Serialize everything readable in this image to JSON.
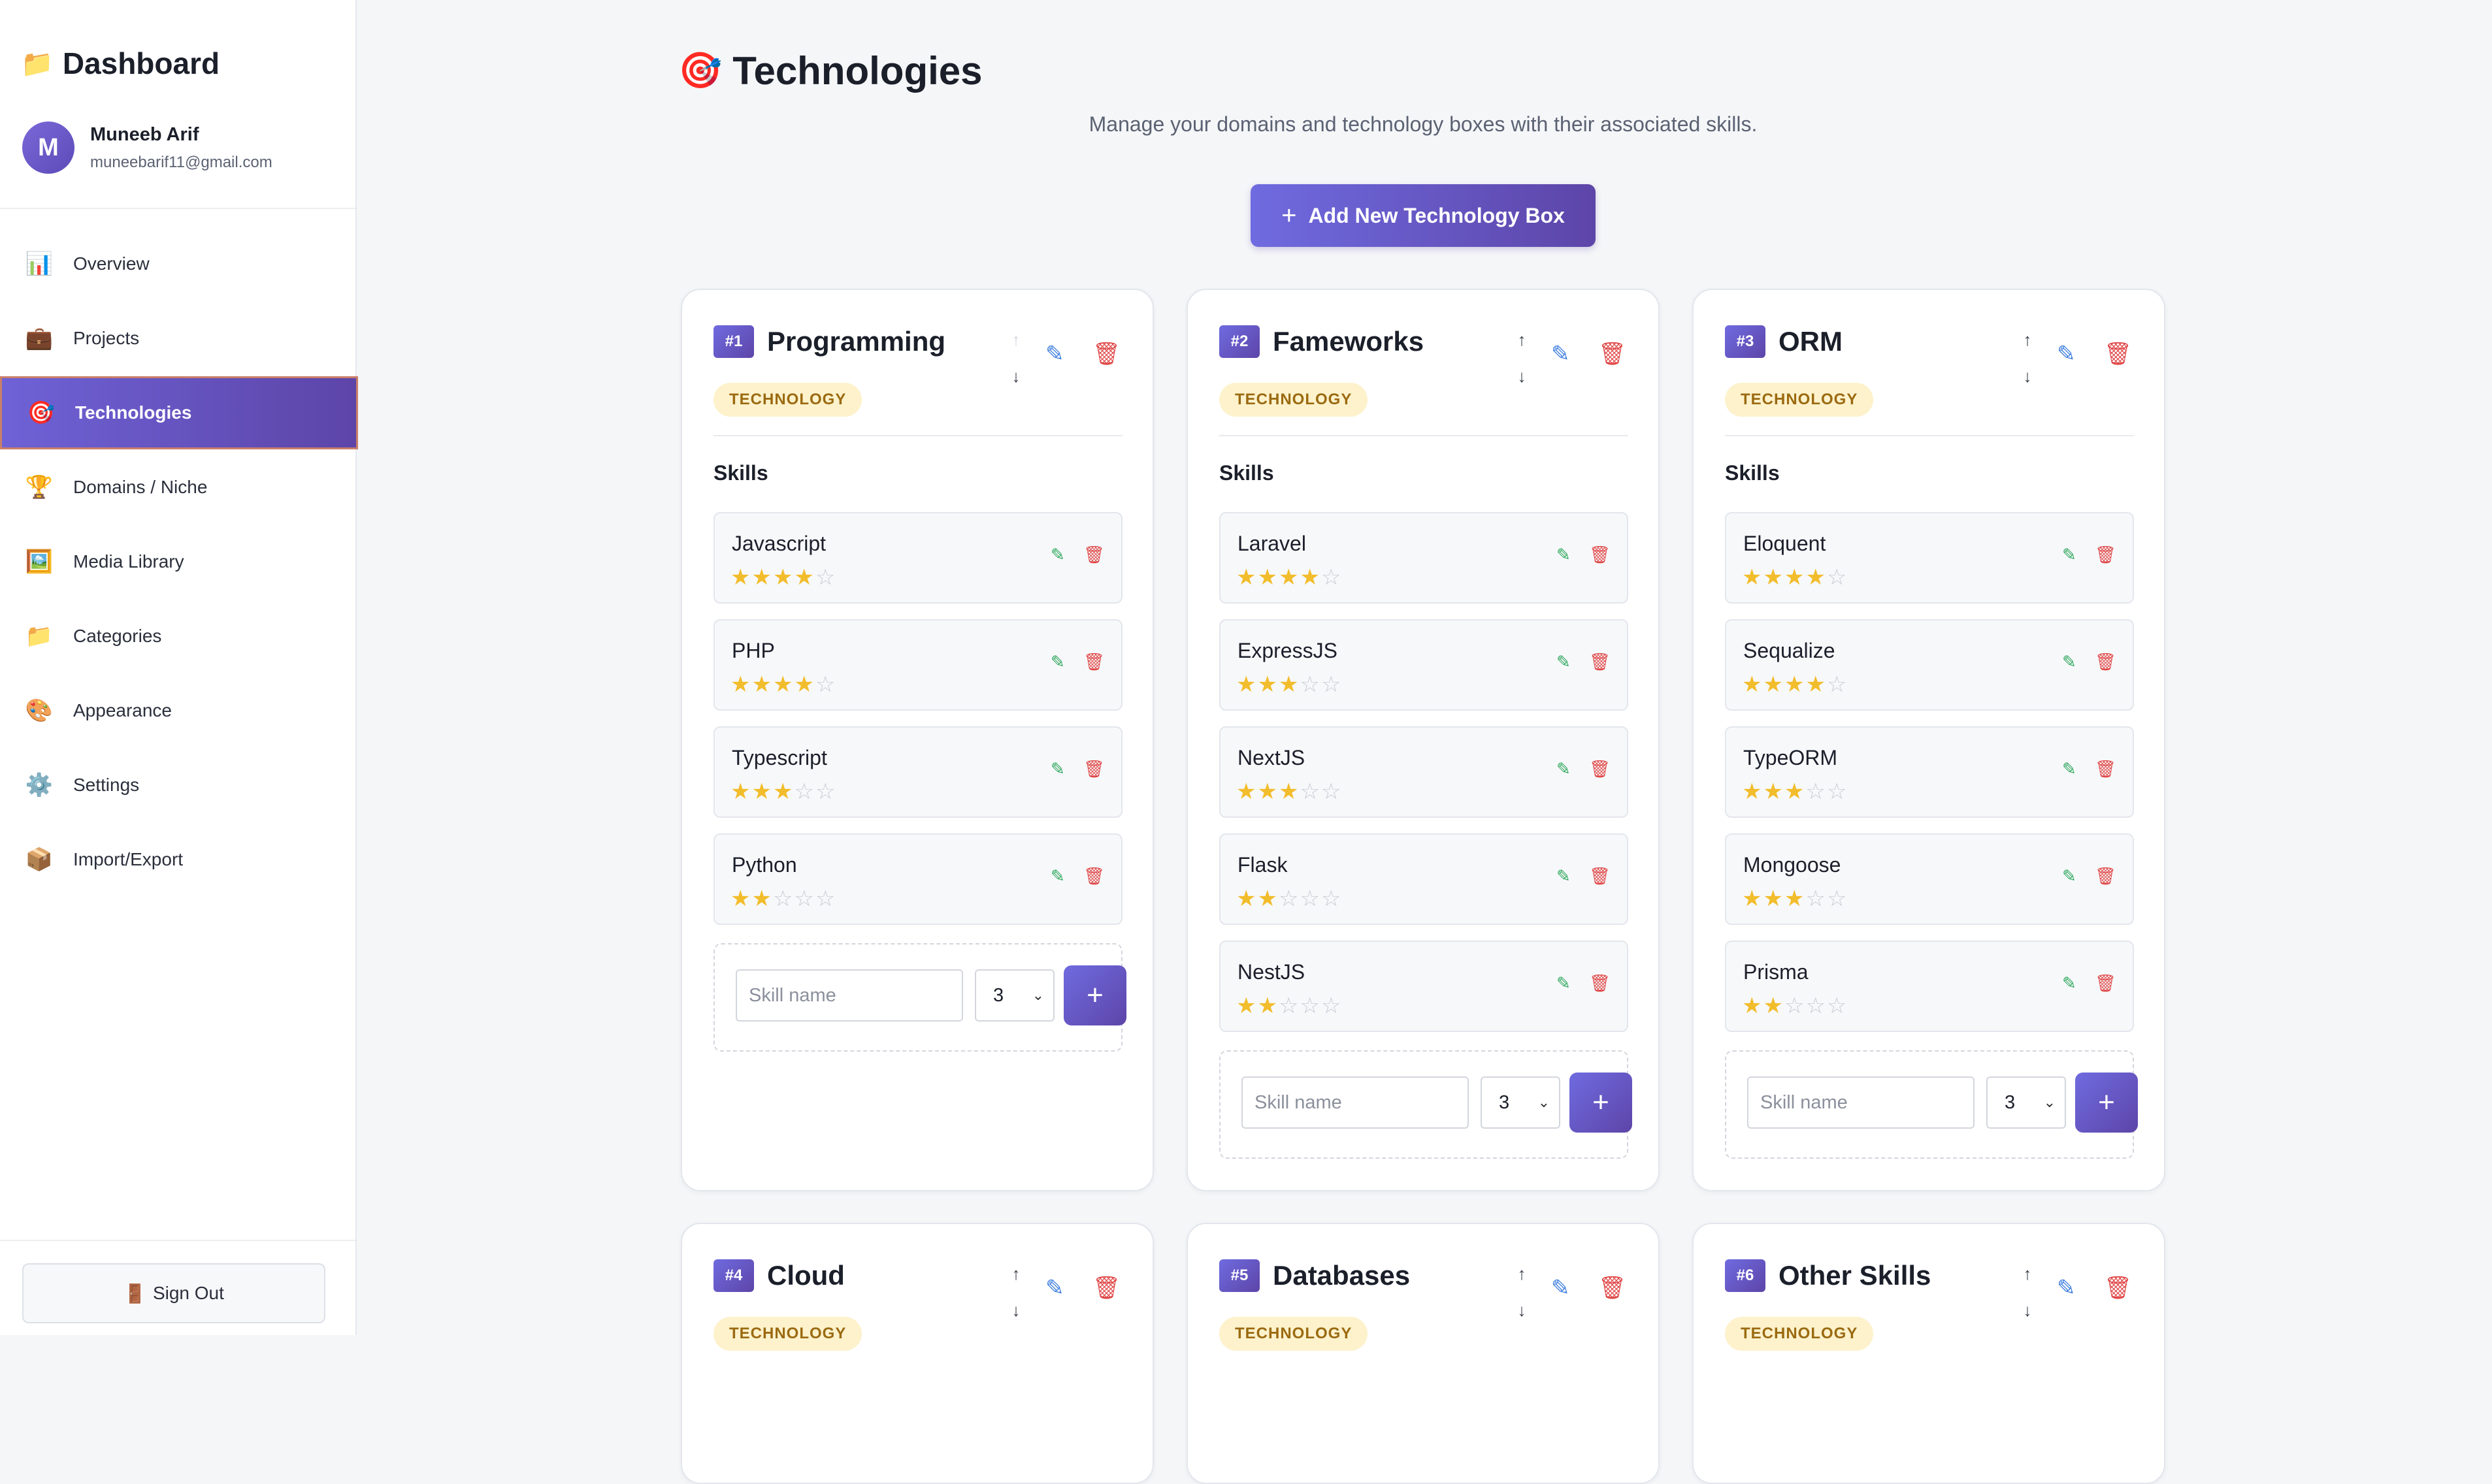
{
  "sidebar": {
    "title": "Dashboard",
    "user": {
      "initial": "M",
      "name": "Muneeb Arif",
      "email": "muneebarif11@gmail.com"
    },
    "items": [
      {
        "icon": "📊",
        "label": "Overview"
      },
      {
        "icon": "💼",
        "label": "Projects"
      },
      {
        "icon": "🎯",
        "label": "Technologies",
        "active": true
      },
      {
        "icon": "🏆",
        "label": "Domains / Niche"
      },
      {
        "icon": "🖼️",
        "label": "Media Library"
      },
      {
        "icon": "📁",
        "label": "Categories"
      },
      {
        "icon": "🎨",
        "label": "Appearance"
      },
      {
        "icon": "⚙️",
        "label": "Settings"
      },
      {
        "icon": "📦",
        "label": "Import/Export"
      }
    ],
    "sign_out": "Sign Out"
  },
  "page": {
    "title": "Technologies",
    "subtitle": "Manage your domains and technology boxes with their associated skills.",
    "add_button": "Add New Technology Box"
  },
  "add_skill": {
    "placeholder": "Skill name",
    "rating": "3"
  },
  "colors": {
    "accent": "#5d45a8",
    "star": "#f2bd2c",
    "tag_bg": "#fdf2cc"
  },
  "cards": [
    {
      "number": "#1",
      "name": "Programming",
      "tag": "TECHNOLOGY",
      "skills_label": "Skills",
      "skills": [
        {
          "name": "Javascript",
          "rating": 4
        },
        {
          "name": "PHP",
          "rating": 4
        },
        {
          "name": "Typescript",
          "rating": 3
        },
        {
          "name": "Python",
          "rating": 2
        }
      ]
    },
    {
      "number": "#2",
      "name": "Fameworks",
      "tag": "TECHNOLOGY",
      "skills_label": "Skills",
      "skills": [
        {
          "name": "Laravel",
          "rating": 4
        },
        {
          "name": "ExpressJS",
          "rating": 3
        },
        {
          "name": "NextJS",
          "rating": 3
        },
        {
          "name": "Flask",
          "rating": 2
        },
        {
          "name": "NestJS",
          "rating": 2
        }
      ]
    },
    {
      "number": "#3",
      "name": "ORM",
      "tag": "TECHNOLOGY",
      "skills_label": "Skills",
      "skills": [
        {
          "name": "Eloquent",
          "rating": 4
        },
        {
          "name": "Sequalize",
          "rating": 4
        },
        {
          "name": "TypeORM",
          "rating": 3
        },
        {
          "name": "Mongoose",
          "rating": 3
        },
        {
          "name": "Prisma",
          "rating": 2
        }
      ]
    },
    {
      "number": "#4",
      "name": "Cloud",
      "tag": "TECHNOLOGY",
      "skills": []
    },
    {
      "number": "#5",
      "name": "Databases",
      "tag": "TECHNOLOGY",
      "skills": []
    },
    {
      "number": "#6",
      "name": "Other Skills",
      "tag": "TECHNOLOGY",
      "skills": []
    }
  ]
}
